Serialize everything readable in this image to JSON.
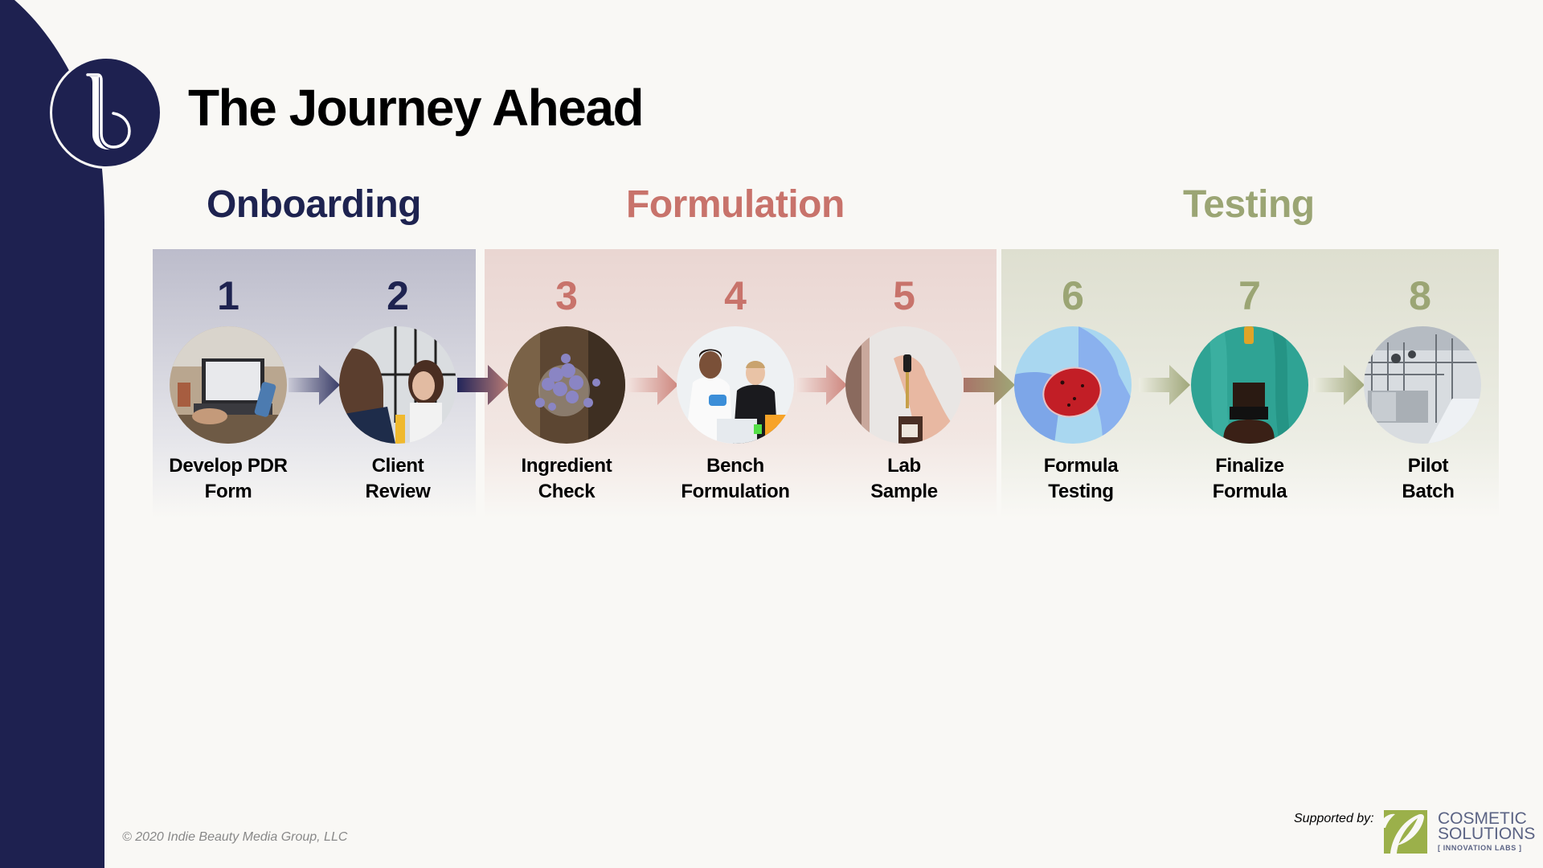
{
  "header": {
    "title": "The Journey Ahead"
  },
  "brand": {
    "logo_icon": "b-monogram-icon",
    "colors": {
      "navy": "#1E2150",
      "background": "#F9F8F5"
    }
  },
  "phases": [
    {
      "name": "Onboarding",
      "color": "#1E2350"
    },
    {
      "name": "Formulation",
      "color": "#C8736B"
    },
    {
      "name": "Testing",
      "color": "#9BA574"
    }
  ],
  "steps": [
    {
      "number": "1",
      "line1": "Develop PDR",
      "line2": "Form",
      "phase": "Onboarding",
      "photo": "laptop-workspace"
    },
    {
      "number": "2",
      "line1": "Client",
      "line2": "Review",
      "phase": "Onboarding",
      "photo": "two-women-meeting"
    },
    {
      "number": "3",
      "line1": "Ingredient",
      "line2": "Check",
      "phase": "Formulation",
      "photo": "lavender-bouquet"
    },
    {
      "number": "4",
      "line1": "Bench",
      "line2": "Formulation",
      "phase": "Formulation",
      "photo": "lab-scientists"
    },
    {
      "number": "5",
      "line1": "Lab",
      "line2": "Sample",
      "phase": "Formulation",
      "photo": "dropper-bottle-hand"
    },
    {
      "number": "6",
      "line1": "Formula",
      "line2": "Testing",
      "phase": "Testing",
      "photo": "gloved-petri-dish"
    },
    {
      "number": "7",
      "line1": "Finalize",
      "line2": "Formula",
      "phase": "Testing",
      "photo": "amber-bottle-dropper"
    },
    {
      "number": "8",
      "line1": "Pilot",
      "line2": "Batch",
      "phase": "Testing",
      "photo": "manufacturing-plant"
    }
  ],
  "footer": {
    "copyright": "© 2020 Indie Beauty Media Group, LLC",
    "supported_by": "Supported by:",
    "sponsor_line1": "COSMETIC",
    "sponsor_line2": "SOLUTIONS",
    "sponsor_sub": "[ INNOVATION LABS ]",
    "sponsor_color": "#9BB04A"
  }
}
